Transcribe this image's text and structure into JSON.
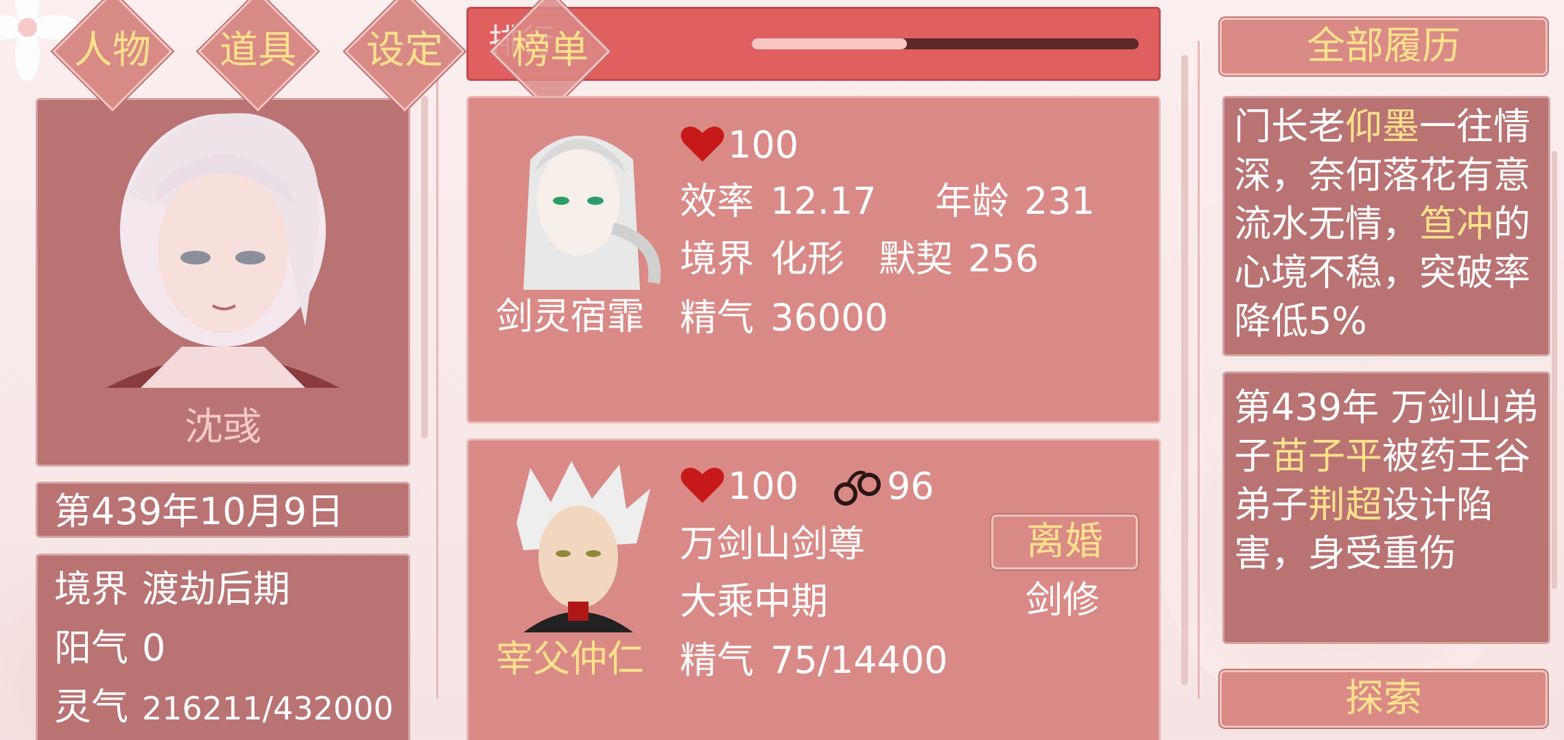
{
  "nav": {
    "character": "人物",
    "items": "道具",
    "settings": "设定",
    "ranking": "榜单",
    "ranking_bg": "排行"
  },
  "left": {
    "name": "沈彧",
    "date": "第439年10月9日",
    "stats": [
      {
        "label": "境界",
        "value": "渡劫后期"
      },
      {
        "label": "阳气",
        "value": "0"
      },
      {
        "label": "灵气",
        "value": "216211/432000"
      }
    ]
  },
  "progress": {
    "fraction": 0.4
  },
  "card1": {
    "name": "剑灵宿霏",
    "affection": "100",
    "efficiency_label": "效率",
    "efficiency": "12.17",
    "age_label": "年龄",
    "age": "231",
    "realm_label": "境界",
    "realm": "化形",
    "bond_label": "默契",
    "bond": "256",
    "essence_label": "精气",
    "essence": "36000"
  },
  "card2": {
    "name": "宰父仲仁",
    "affection": "100",
    "restraint": "96",
    "title": "万剑山剑尊",
    "realm": "大乘中期",
    "essence_label": "精气",
    "essence": "75/14400",
    "divorce": "离婚",
    "class": "剑修"
  },
  "right": {
    "history_button": "全部履历",
    "explore_button": "探索",
    "log1": {
      "p1": "门长老",
      "h1": "仰墨",
      "p2": "一往情深，奈何落花有意流水无情，",
      "h2": "笪冲",
      "p3": "的心境不稳，突破率降低5%"
    },
    "log2": {
      "p1": "第439年 万剑山弟子",
      "h1": "苗子平",
      "p2": "被药王谷弟子",
      "h2": "荆超",
      "p3": "设计陷害，身受重伤"
    }
  },
  "colors": {
    "accent": "#ffe28a",
    "panel": "#b97373",
    "card": "#d98a86",
    "header": "#e06060"
  },
  "icons": [
    "heart-icon",
    "handcuffs-icon",
    "flower-icon"
  ]
}
